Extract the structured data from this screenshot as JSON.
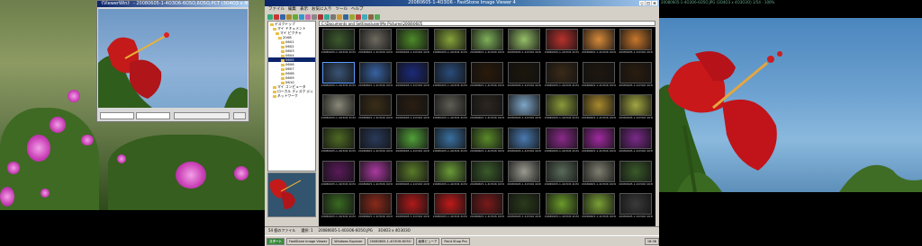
{
  "left_monitor": {
    "viewer": {
      "title": "《ViewerWin》 - 20080605-1-4O3O6-6O5O,6O5O,PCT (3O4O3 x 4O3O3O) 23% / 2.8"
    }
  },
  "explorer": {
    "title": "20080605-1-4O3O6 - FastStone Image Viewer 4",
    "menu": [
      "ファイル",
      "編集",
      "表示",
      "お気に入り",
      "ツール",
      "ヘルプ"
    ],
    "address": "C:\\Documents and Settings\\user\\My Pictures\\2008\\0605",
    "tree": [
      "デスクトップ",
      "マイ ドキュメント",
      "マイ ピクチャ",
      "2008",
      "0601",
      "0602",
      "0603",
      "0604",
      "0605",
      "0606",
      "0607",
      "0608",
      "0609",
      "0610",
      "マイ コンピュータ",
      "ローカル ディスク (C:)",
      "ネットワーク"
    ],
    "thumbnail_caption": "20080605-1-4O3O6 4O3O3 x 3O4O3",
    "thumb_colors": [
      "#3c5a2e",
      "#6e6a60",
      "#4f8a2a",
      "#86a33a",
      "#7fb05a",
      "#96bf68",
      "#b8322e",
      "#d88a3a",
      "#c8772c",
      "#3a5476",
      "#3862a0",
      "#1c2a7a",
      "#2a4c7a",
      "#2a1a0a",
      "#1c160c",
      "#3a2a18",
      "#1e1710",
      "#2b1d10",
      "#8a8878",
      "#3a2e18",
      "#2a1e12",
      "#5e5d55",
      "#2c2620",
      "#7fa6c8",
      "#8a9a3a",
      "#a88a2e",
      "#a2a642",
      "#4e6a24",
      "#2a3a5a",
      "#52a03a",
      "#3a70a0",
      "#5a8a2a",
      "#4a7ab0",
      "#8a2a8a",
      "#a02aa0",
      "#7a2a8a",
      "#5a1a5a",
      "#aa3aa0",
      "#5a7a2a",
      "#6a9a38",
      "#3a5a2a",
      "#9a9a90",
      "#5a6a5a",
      "#7e7e70",
      "#3a5a2a",
      "#3a6a22",
      "#8a2a1a",
      "#b01a1a",
      "#c01a1a",
      "#7a1a1a",
      "#2a3a1a",
      "#6a9a2a",
      "#7aa036",
      "#3a3a3a"
    ],
    "status": [
      "54 個のファイル",
      "選択: 1",
      "20080605-1-4O3O6-6O5O.JPG",
      "3O4O3 x 4O3O3O"
    ],
    "taskbar": {
      "start": "スタート",
      "tasks": [
        "FastStone Image Viewer",
        "Windows Explorer",
        "20080605-1-4O3O6-6O5O",
        "画像ビューア",
        "Paint Shop Pro"
      ],
      "clock": "18:38"
    }
  },
  "right_monitor": {
    "caption": "20080605-1-4O3O6-6O5O.JPG (3O4O3 x 4O3O3O) 1/54 - 100%"
  }
}
